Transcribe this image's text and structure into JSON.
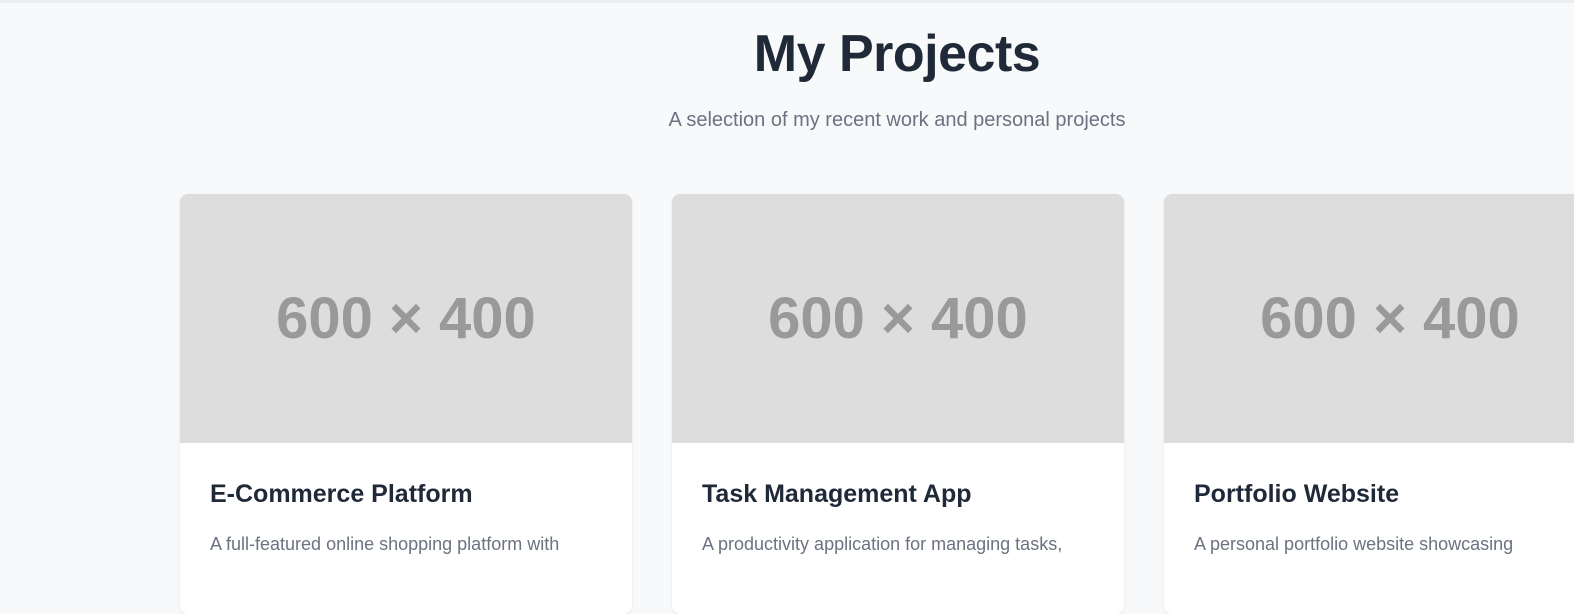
{
  "section": {
    "title": "My Projects",
    "subtitle": "A selection of my recent work and personal projects"
  },
  "projects": [
    {
      "image_placeholder": "600 × 400",
      "title": "E-Commerce Platform",
      "description": "A full-featured online shopping platform with"
    },
    {
      "image_placeholder": "600 × 400",
      "title": "Task Management App",
      "description": "A productivity application for managing tasks,"
    },
    {
      "image_placeholder": "600 × 400",
      "title": "Portfolio Website",
      "description": "A personal portfolio website showcasing"
    }
  ]
}
